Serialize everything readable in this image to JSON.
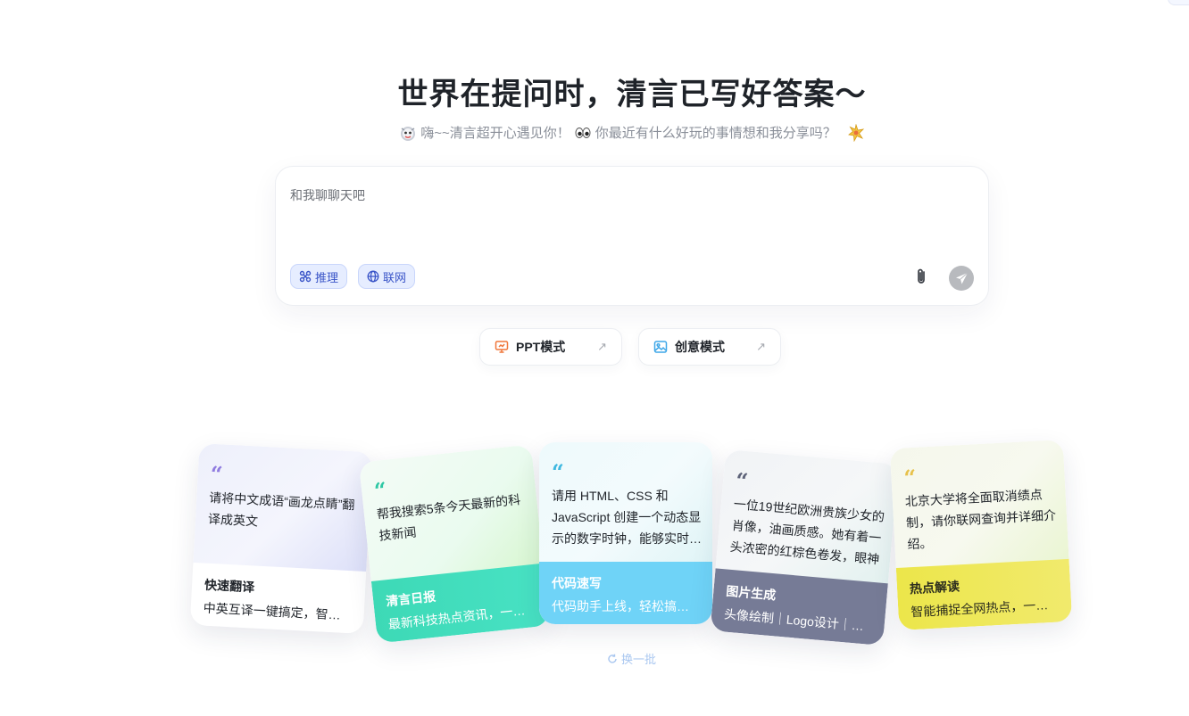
{
  "header": {
    "title": "世界在提问时，清言已写好答案～",
    "subtitle_part1": "嗨~~清言超开心遇见你！",
    "subtitle_part2": "你最近有什么好玩的事情想和我分享吗？"
  },
  "input": {
    "placeholder": "和我聊聊天吧",
    "chips": [
      {
        "label": "推理",
        "icon": "reasoning-icon"
      },
      {
        "label": "联网",
        "icon": "globe-icon"
      }
    ]
  },
  "modes": [
    {
      "label": "PPT模式",
      "icon": "presentation-icon"
    },
    {
      "label": "创意模式",
      "icon": "image-icon"
    }
  ],
  "cards": [
    {
      "prompt": "请将中文成语“画龙点睛”翻译成英文",
      "label": "快速翻译",
      "desc": "中英互译一键搞定，智能准确",
      "quote_color": "#8f7be0"
    },
    {
      "prompt": "帮我搜索5条今天最新的科技新闻",
      "label": "清言日报",
      "desc": "最新科技热点资讯，一键获取",
      "quote_color": "#2ec7a4"
    },
    {
      "prompt": "请用 HTML、CSS 和 JavaScript 创建一个动态显示的数字时钟，能够实时、准确",
      "label": "代码速写",
      "desc": "代码助手上线，轻松搞定编程",
      "quote_color": "#3fb8e0"
    },
    {
      "prompt": "一位19世纪欧洲贵族少女的肖像，油画质感。她有着一头浓密的红棕色卷发，眼神",
      "label": "图片生成",
      "desc": "头像绘制｜Logo设计｜海报",
      "quote_color": "#5d6278"
    },
    {
      "prompt": "北京大学将全面取消绩点制，请你联网查询并详细介绍。",
      "label": "热点解读",
      "desc": "智能捕捉全网热点，一键解读",
      "quote_color": "#e7c14a"
    }
  ],
  "refresh_label": "换一批"
}
